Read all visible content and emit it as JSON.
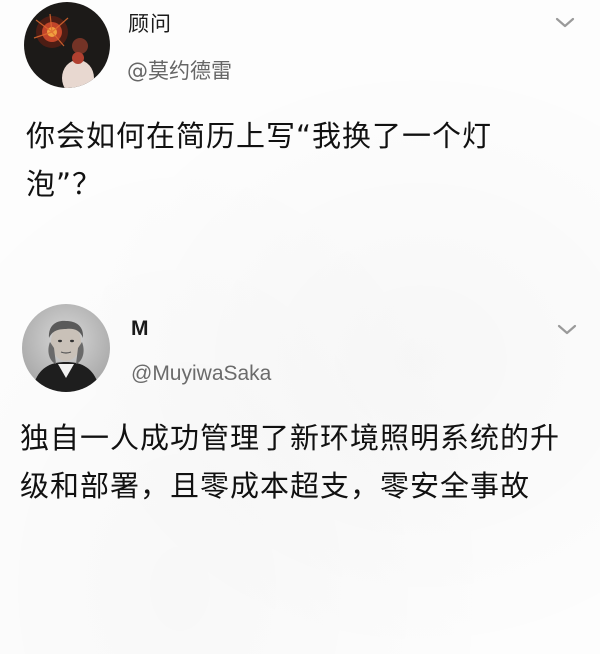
{
  "tweets": [
    {
      "display_name": "顾问",
      "handle": "@莫约德雷",
      "text": "你会如何在简历上写“我换了一个灯泡”？"
    },
    {
      "display_name": "M",
      "handle": "@MuyiwaSaka",
      "text": "独自一人成功管理了新环境照明系统的升级和部署，且零成本超支，零安全事故"
    }
  ],
  "icons": {
    "menu": "chevron-down-icon"
  }
}
